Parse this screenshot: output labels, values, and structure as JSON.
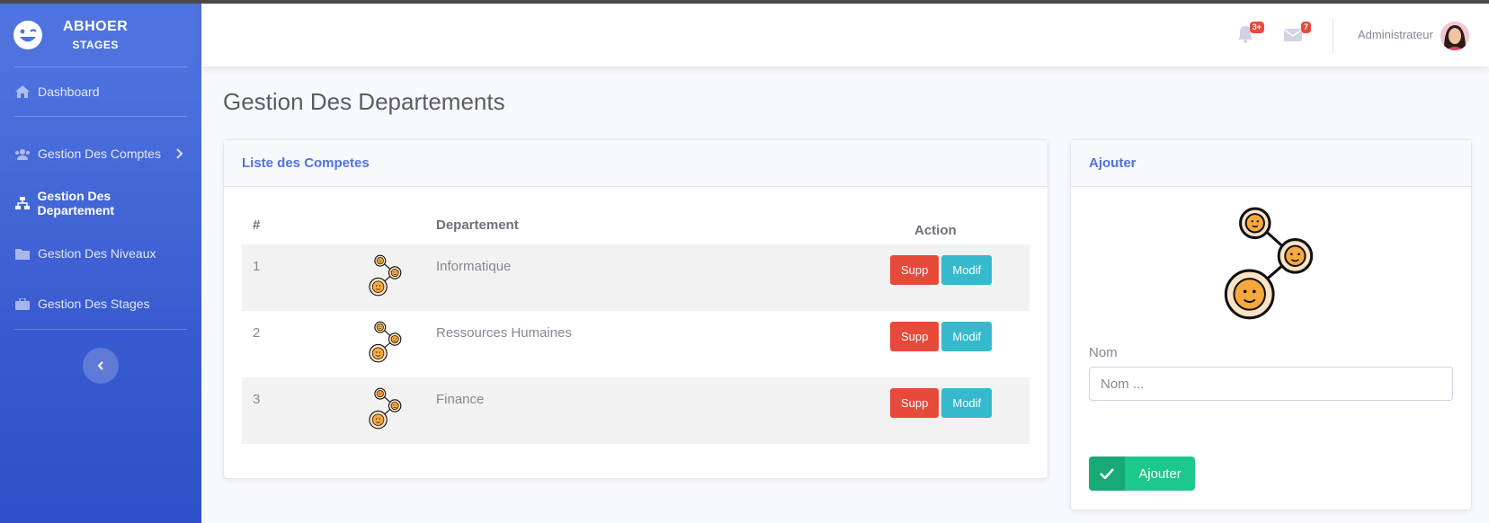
{
  "brand": {
    "title": "ABHOER",
    "subtitle": "STAGES"
  },
  "sidebar": {
    "items": [
      {
        "label": "Dashboard",
        "icon": "home-icon"
      },
      {
        "label": "Gestion Des Comptes",
        "icon": "users-icon"
      },
      {
        "label": "Gestion Des Departement",
        "icon": "sitemap-icon"
      },
      {
        "label": "Gestion Des Niveaux",
        "icon": "folder-icon"
      },
      {
        "label": "Gestion Des Stages",
        "icon": "briefcase-icon"
      }
    ]
  },
  "topbar": {
    "alerts_badge": "3+",
    "messages_badge": "7",
    "user_name": "Administrateur"
  },
  "page": {
    "title": "Gestion Des Departements"
  },
  "list_card": {
    "header": "Liste des Competes",
    "columns": [
      "#",
      "Departement",
      "Action"
    ],
    "rows": [
      {
        "num": "1",
        "name": "Informatique"
      },
      {
        "num": "2",
        "name": "Ressources Humaines"
      },
      {
        "num": "3",
        "name": "Finance"
      }
    ],
    "delete_label": "Supp",
    "edit_label": "Modif"
  },
  "add_card": {
    "header": "Ajouter",
    "field_label": "Nom",
    "field_placeholder": "Nom ...",
    "field_value": "",
    "button_label": "Ajouter"
  },
  "colors": {
    "primary": "#4e73df",
    "danger": "#e74a3b",
    "info": "#36b9cc",
    "success": "#1cc88a"
  }
}
